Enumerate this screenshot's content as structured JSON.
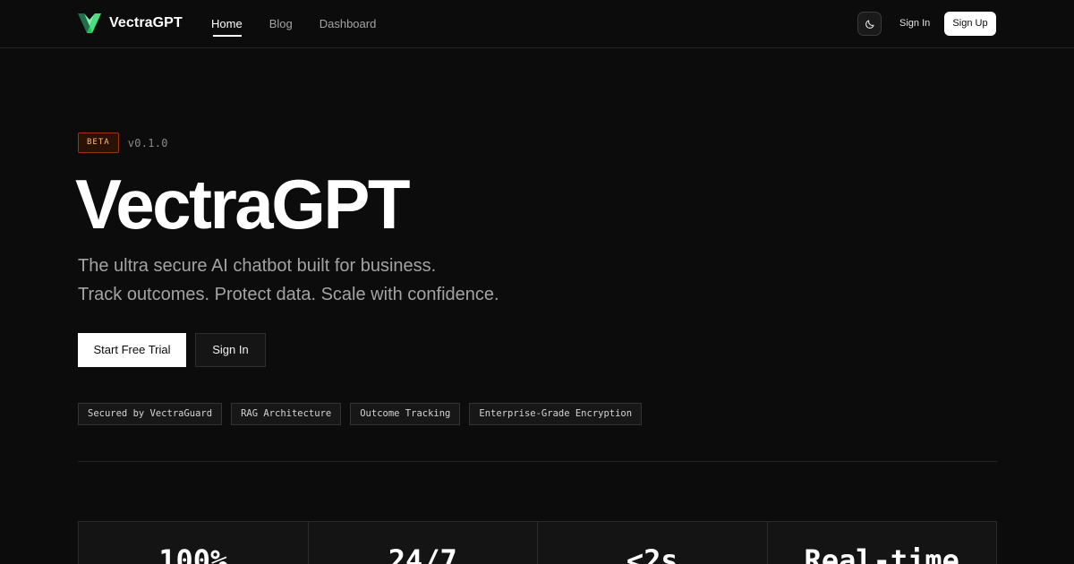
{
  "brand": {
    "name": "VectraGPT",
    "logo_icon": "v-logo-icon",
    "logo_colors": [
      "#1f6f4a",
      "#4ade80",
      "#86efac"
    ]
  },
  "nav": {
    "links": [
      {
        "label": "Home",
        "active": true
      },
      {
        "label": "Blog",
        "active": false
      },
      {
        "label": "Dashboard",
        "active": false
      }
    ]
  },
  "header_actions": {
    "theme_icon": "moon-icon",
    "sign_in": "Sign In",
    "sign_up": "Sign Up"
  },
  "hero": {
    "badge": "BETA",
    "version": "v0.1.0",
    "title": "VectraGPT",
    "subtitle_line1": "The ultra secure AI chatbot built for business.",
    "subtitle_line2": "Track outcomes. Protect data. Scale with confidence.",
    "primary_cta": "Start Free Trial",
    "secondary_cta": "Sign In",
    "tags": [
      "Secured by VectraGuard",
      "RAG Architecture",
      "Outcome Tracking",
      "Enterprise-Grade Encryption"
    ]
  },
  "stats": [
    {
      "value": "100%"
    },
    {
      "value": "24/7"
    },
    {
      "value": "<2s"
    },
    {
      "value": "Real-time"
    }
  ],
  "colors": {
    "background": "#0c0c0c",
    "accent_badge": "#fdba74",
    "badge_border": "#9a3412",
    "text_muted": "#a3a3a3"
  }
}
